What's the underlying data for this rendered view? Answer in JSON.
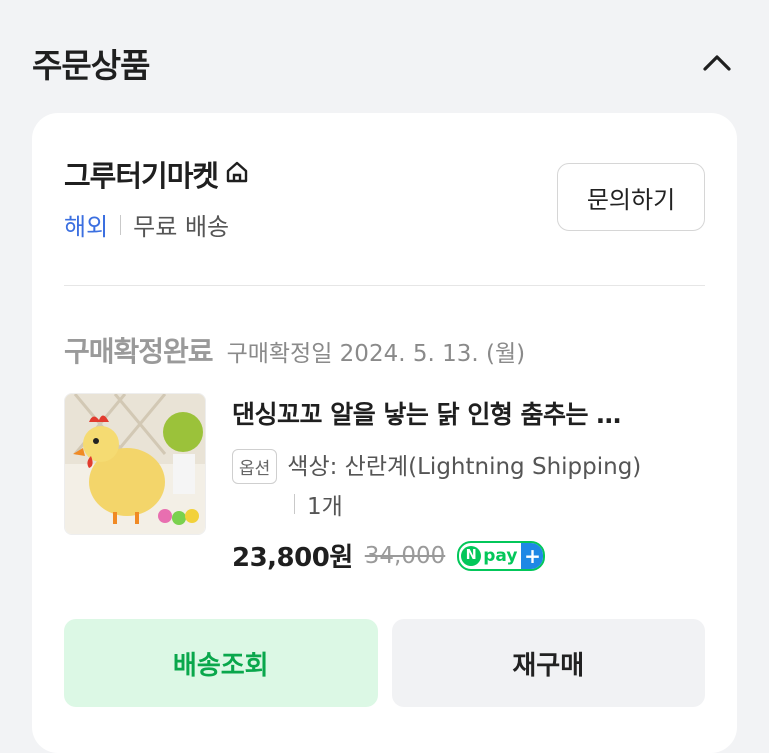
{
  "section": {
    "title": "주문상품"
  },
  "seller": {
    "name": "그루터기마켓",
    "region": "해외",
    "shipping": "무료 배송",
    "inquiry_label": "문의하기"
  },
  "order": {
    "status": "구매확정완료",
    "confirm_date": "구매확정일 2024. 5. 13. (월)"
  },
  "product": {
    "name": "댄싱꼬꼬 알을 낳는 닭 인형 춤추는 …",
    "option_badge": "옵션",
    "option_text": "색상: 산란계(Lightning Shipping)",
    "quantity": "1개",
    "price": "23,800원",
    "original_price": "34,000",
    "npay_text": "pay"
  },
  "actions": {
    "track_label": "배송조회",
    "rebuy_label": "재구매"
  },
  "colors": {
    "accent_green": "#0aa74c",
    "link_blue": "#3b6fe0",
    "npay_green": "#03c75a"
  }
}
